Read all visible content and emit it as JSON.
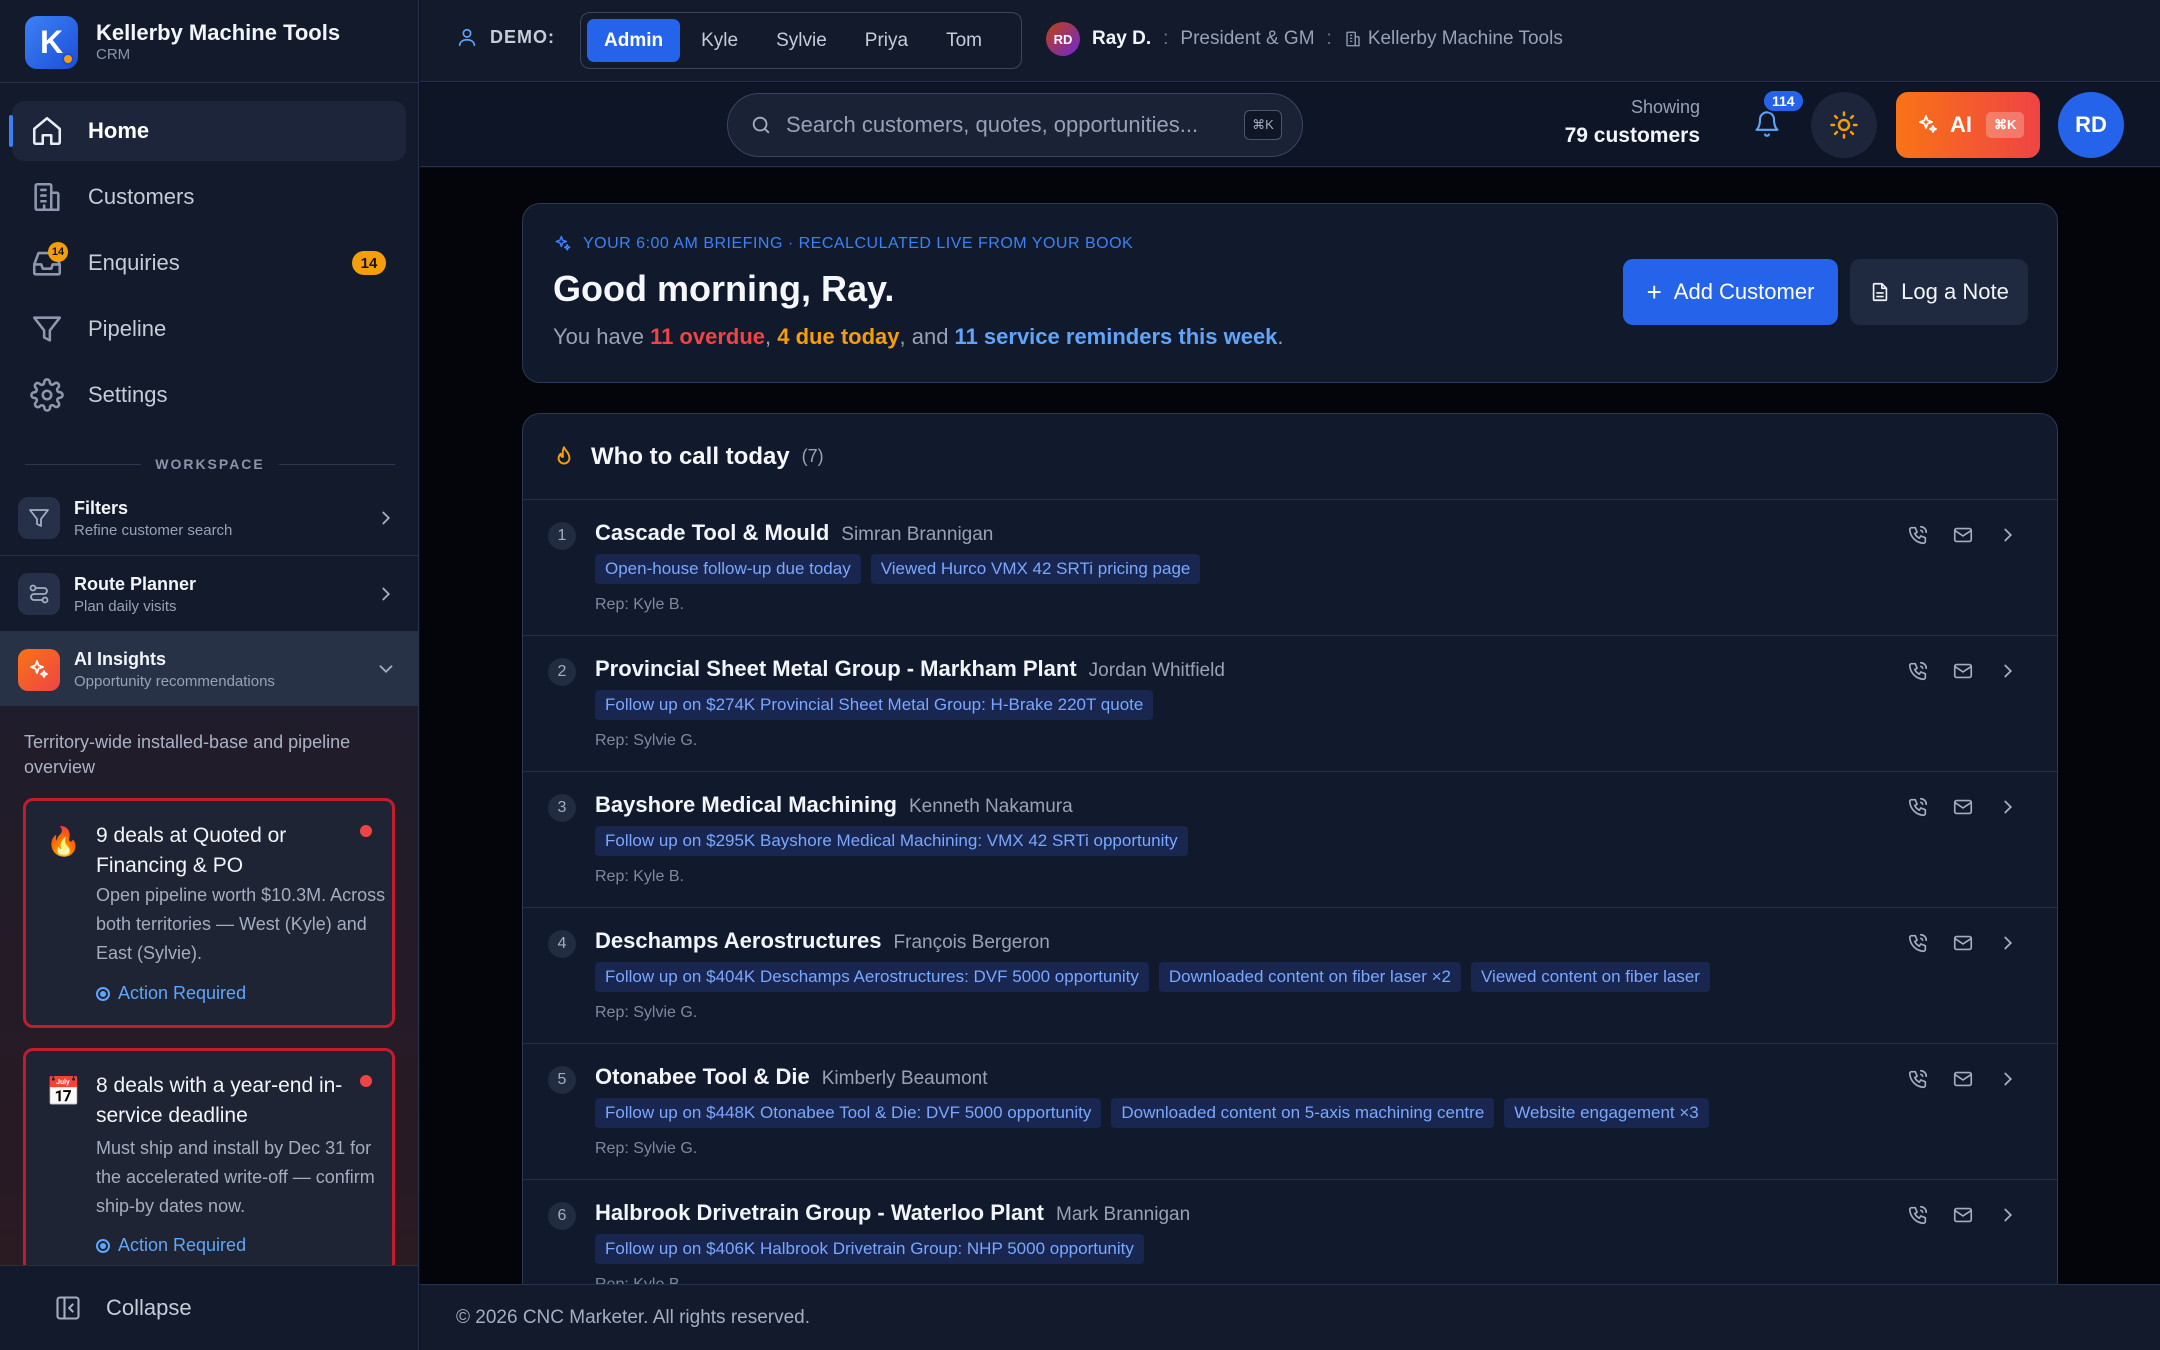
{
  "brand": {
    "logo_letter": "K",
    "name": "Kellerby Machine Tools",
    "sub": "CRM"
  },
  "nav": {
    "items": [
      {
        "label": "Home",
        "icon": "home-icon"
      },
      {
        "label": "Customers",
        "icon": "building-icon"
      },
      {
        "label": "Enquiries",
        "icon": "inbox-icon",
        "badge": "14",
        "icon_badge": "14"
      },
      {
        "label": "Pipeline",
        "icon": "filter-funnel-icon"
      },
      {
        "label": "Settings",
        "icon": "gear-icon"
      }
    ]
  },
  "workspace": {
    "title": "WORKSPACE",
    "items": [
      {
        "title": "Filters",
        "sub": "Refine customer search",
        "icon": "filter-icon"
      },
      {
        "title": "Route Planner",
        "sub": "Plan daily visits",
        "icon": "route-icon"
      },
      {
        "title": "AI Insights",
        "sub": "Opportunity recommendations",
        "icon": "sparkles-icon"
      }
    ]
  },
  "ai_insights": {
    "intro": "Territory-wide installed-base and pipeline overview",
    "cards": [
      {
        "emoji": "🔥",
        "title": "9 deals at Quoted or Financing & PO",
        "body": "Open pipeline worth $10.3M. Across both territories — West (Kyle) and East (Sylvie).",
        "action": "Action Required"
      },
      {
        "emoji": "📅",
        "title": "8 deals with a year-end in-service deadline",
        "body": "Must ship and install by Dec 31 for the accelerated write-off — confirm ship-by dates now.",
        "action": "Action Required"
      }
    ]
  },
  "collapse_label": "Collapse",
  "topbar": {
    "demo_label": "DEMO:",
    "demo_users": [
      "Admin",
      "Kyle",
      "Sylvie",
      "Priya",
      "Tom"
    ],
    "demo_active": "Admin",
    "user": {
      "initials": "RD",
      "name": "Ray D.",
      "role": "President & GM",
      "company": "Kellerby Machine Tools"
    }
  },
  "header": {
    "search_placeholder": "Search customers, quotes, opportunities...",
    "search_kbd": "⌘K",
    "showing_label": "Showing",
    "showing_value": "79 customers",
    "notifications": "114",
    "ai_label": "AI",
    "ai_kbd": "⌘K",
    "avatar": "RD"
  },
  "briefing": {
    "tag": "YOUR 6:00 AM BRIEFING · RECALCULATED LIVE FROM YOUR BOOK",
    "title": "Good morning, Ray.",
    "prefix": "You have ",
    "overdue": "11 overdue",
    "sep1": ", ",
    "due_today": "4 due today",
    "sep2": ", and ",
    "reminders": "11 service reminders this week",
    "suffix": ".",
    "add_customer": "Add Customer",
    "log_note": "Log a Note"
  },
  "calls": {
    "title": "Who to call today",
    "count": "(7)",
    "rows": [
      {
        "num": "1",
        "company": "Cascade Tool & Mould",
        "contact": "Simran Brannigan",
        "tags": [
          "Open-house follow-up due today",
          "Viewed Hurco VMX 42 SRTi pricing page"
        ],
        "rep": "Rep: Kyle B."
      },
      {
        "num": "2",
        "company": "Provincial Sheet Metal Group - Markham Plant",
        "contact": "Jordan Whitfield",
        "tags": [
          "Follow up on $274K Provincial Sheet Metal Group: H-Brake 220T quote"
        ],
        "rep": "Rep: Sylvie G."
      },
      {
        "num": "3",
        "company": "Bayshore Medical Machining",
        "contact": "Kenneth Nakamura",
        "tags": [
          "Follow up on $295K Bayshore Medical Machining: VMX 42 SRTi opportunity"
        ],
        "rep": "Rep: Kyle B."
      },
      {
        "num": "4",
        "company": "Deschamps Aerostructures",
        "contact": "François Bergeron",
        "tags": [
          "Follow up on $404K Deschamps Aerostructures: DVF 5000 opportunity",
          "Downloaded content on fiber laser ×2",
          "Viewed content on fiber laser"
        ],
        "rep": "Rep: Sylvie G."
      },
      {
        "num": "5",
        "company": "Otonabee Tool & Die",
        "contact": "Kimberly Beaumont",
        "tags": [
          "Follow up on $448K Otonabee Tool & Die: DVF 5000 opportunity",
          "Downloaded content on 5-axis machining centre",
          "Website engagement ×3"
        ],
        "rep": "Rep: Sylvie G."
      },
      {
        "num": "6",
        "company": "Halbrook Drivetrain Group - Waterloo Plant",
        "contact": "Mark Brannigan",
        "tags": [
          "Follow up on $406K Halbrook Drivetrain Group: NHP 5000 opportunity"
        ],
        "rep": "Rep: Kyle B."
      }
    ]
  },
  "footer": "© 2026 CNC Marketer. All rights reserved.",
  "colors": {
    "accent": "#2563eb",
    "overdue": "#ef4444",
    "due": "#f59e0b",
    "reminder": "#60a5fa",
    "alert_border": "#c21d2c"
  }
}
